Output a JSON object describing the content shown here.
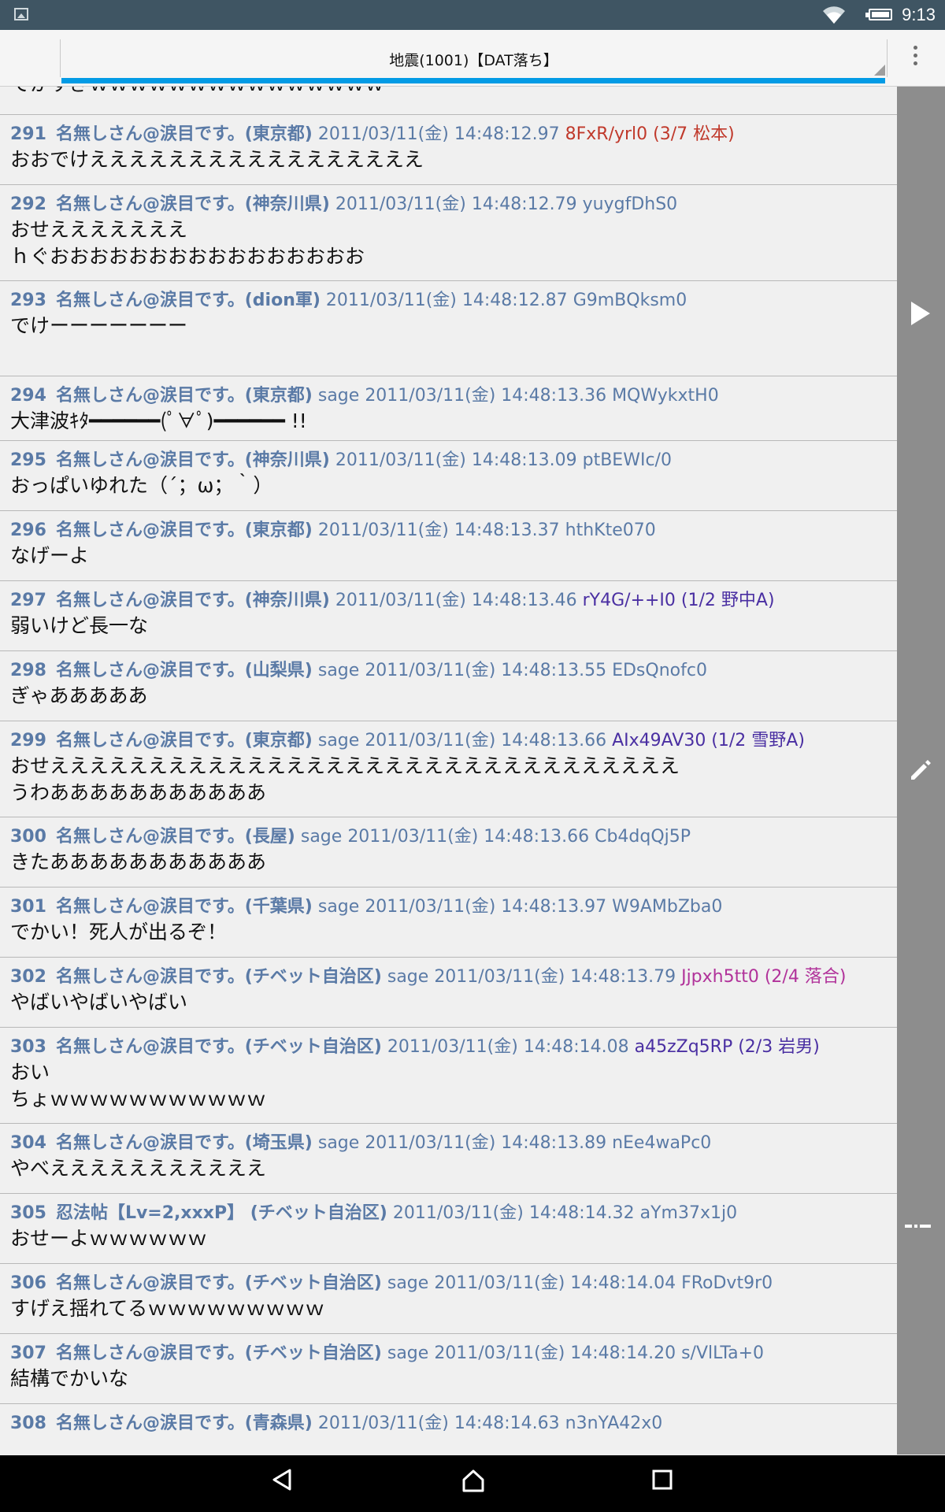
{
  "status_bar": {
    "time": "9:13"
  },
  "header": {
    "title": "地震(1001)【DAT落ち】"
  },
  "posts": [
    {
      "num": "",
      "name": "",
      "mail": "",
      "date": "",
      "id": "",
      "id_color": "plain",
      "lines": [
        "でかすぎｗｗｗｗｗｗｗｗｗｗｗｗｗｗｗ"
      ]
    },
    {
      "num": "291",
      "name": "名無しさん@涙目です。(東京都)",
      "mail": "",
      "date": "2011/03/11(金) 14:48:12.97",
      "id": "8FxR/yrl0 (3/7 松本)",
      "id_color": "red",
      "lines": [
        "おおでけえええええええええええええええええ"
      ]
    },
    {
      "num": "292",
      "name": "名無しさん@涙目です。(神奈川県)",
      "mail": "",
      "date": "2011/03/11(金) 14:48:12.79",
      "id": "yuygfDhS0",
      "id_color": "plain",
      "lines": [
        "おせえええええええ",
        "ｈぐおおおおおおおおおおおおおおおお"
      ]
    },
    {
      "num": "293",
      "name": "名無しさん@涙目です。(dion軍)",
      "mail": "",
      "date": "2011/03/11(金) 14:48:12.87",
      "id": "G9mBQksm0",
      "id_color": "plain",
      "lines": [
        "でけーーーーーーー",
        " "
      ]
    },
    {
      "num": "294",
      "name": "名無しさん@涙目です。(東京都)",
      "mail": "sage",
      "date": "2011/03/11(金) 14:48:13.36",
      "id": "MQWykxtH0",
      "id_color": "plain",
      "lines": [
        "大津波ｷﾀ━━━━━━(ﾟ∀ﾟ)━━━━━━ !!"
      ]
    },
    {
      "num": "295",
      "name": "名無しさん@涙目です。(神奈川県)",
      "mail": "",
      "date": "2011/03/11(金) 14:48:13.09",
      "id": "ptBEWIc/0",
      "id_color": "plain",
      "lines": [
        "おっぱいゆれた（´；ω；｀）"
      ]
    },
    {
      "num": "296",
      "name": "名無しさん@涙目です。(東京都)",
      "mail": "",
      "date": "2011/03/11(金) 14:48:13.37",
      "id": "hthKte070",
      "id_color": "plain",
      "lines": [
        "なげーよ"
      ]
    },
    {
      "num": "297",
      "name": "名無しさん@涙目です。(神奈川県)",
      "mail": "",
      "date": "2011/03/11(金) 14:48:13.46",
      "id": "rY4G/++I0 (1/2 野中A)",
      "id_color": "purple",
      "lines": [
        "弱いけど長一な"
      ]
    },
    {
      "num": "298",
      "name": "名無しさん@涙目です。(山梨県)",
      "mail": "sage",
      "date": "2011/03/11(金) 14:48:13.55",
      "id": "EDsQnofc0",
      "id_color": "plain",
      "lines": [
        "ぎゃあああああ"
      ]
    },
    {
      "num": "299",
      "name": "名無しさん@涙目です。(東京都)",
      "mail": "sage",
      "date": "2011/03/11(金) 14:48:13.66",
      "id": "AIx49AV30 (1/2 雪野A)",
      "id_color": "purple",
      "lines": [
        "おせええええええええええええええええええええええええええええええええ",
        "うわあああああああああああ"
      ]
    },
    {
      "num": "300",
      "name": "名無しさん@涙目です。(長屋)",
      "mail": "sage",
      "date": "2011/03/11(金) 14:48:13.66",
      "id": "Cb4dqQj5P",
      "id_color": "plain",
      "lines": [
        "きたあああああああああああ"
      ]
    },
    {
      "num": "301",
      "name": "名無しさん@涙目です。(千葉県)",
      "mail": "sage",
      "date": "2011/03/11(金) 14:48:13.97",
      "id": "W9AMbZba0",
      "id_color": "plain",
      "lines": [
        "でかい！死人が出るぞ！"
      ]
    },
    {
      "num": "302",
      "name": "名無しさん@涙目です。(チベット自治区)",
      "mail": "sage",
      "date": "2011/03/11(金) 14:48:13.79",
      "id": "Jjpxh5tt0 (2/4 落合)",
      "id_color": "magenta",
      "lines": [
        "やばいやばいやばい"
      ]
    },
    {
      "num": "303",
      "name": "名無しさん@涙目です。(チベット自治区)",
      "mail": "",
      "date": "2011/03/11(金) 14:48:14.08",
      "id": "a45zZq5RP (2/3 岩男)",
      "id_color": "purple",
      "lines": [
        "おい",
        "ちょｗｗｗｗｗｗｗｗｗｗｗ"
      ]
    },
    {
      "num": "304",
      "name": "名無しさん@涙目です。(埼玉県)",
      "mail": "sage",
      "date": "2011/03/11(金) 14:48:13.89",
      "id": "nEe4waPc0",
      "id_color": "plain",
      "lines": [
        "やべえええええええええええ"
      ]
    },
    {
      "num": "305",
      "name": "忍法帖【Lv=2,xxxP】 (チベット自治区)",
      "mail": "",
      "date": "2011/03/11(金) 14:48:14.32",
      "id": "aYm37x1j0",
      "id_color": "plain",
      "lines": [
        "おせーよｗｗｗｗｗｗ"
      ]
    },
    {
      "num": "306",
      "name": "名無しさん@涙目です。(チベット自治区)",
      "mail": "sage",
      "date": "2011/03/11(金) 14:48:14.04",
      "id": "FRoDvt9r0",
      "id_color": "plain",
      "lines": [
        "すげえ揺れてるｗｗｗｗｗｗｗｗｗ"
      ]
    },
    {
      "num": "307",
      "name": "名無しさん@涙目です。(チベット自治区)",
      "mail": "sage",
      "date": "2011/03/11(金) 14:48:14.20",
      "id": "s/VlLTa+0",
      "id_color": "plain",
      "lines": [
        "結構でかいな"
      ]
    },
    {
      "num": "308",
      "name": "名無しさん@涙目です。(青森県)",
      "mail": "",
      "date": "2011/03/11(金) 14:48:14.63",
      "id": "n3nYA42x0",
      "id_color": "plain",
      "lines": []
    }
  ],
  "icons": {
    "side_play": "play-icon",
    "side_write": "pencil-icon",
    "side_split": "split-icon",
    "nav_back": "back-icon",
    "nav_home": "home-icon",
    "nav_recents": "recents-icon"
  }
}
